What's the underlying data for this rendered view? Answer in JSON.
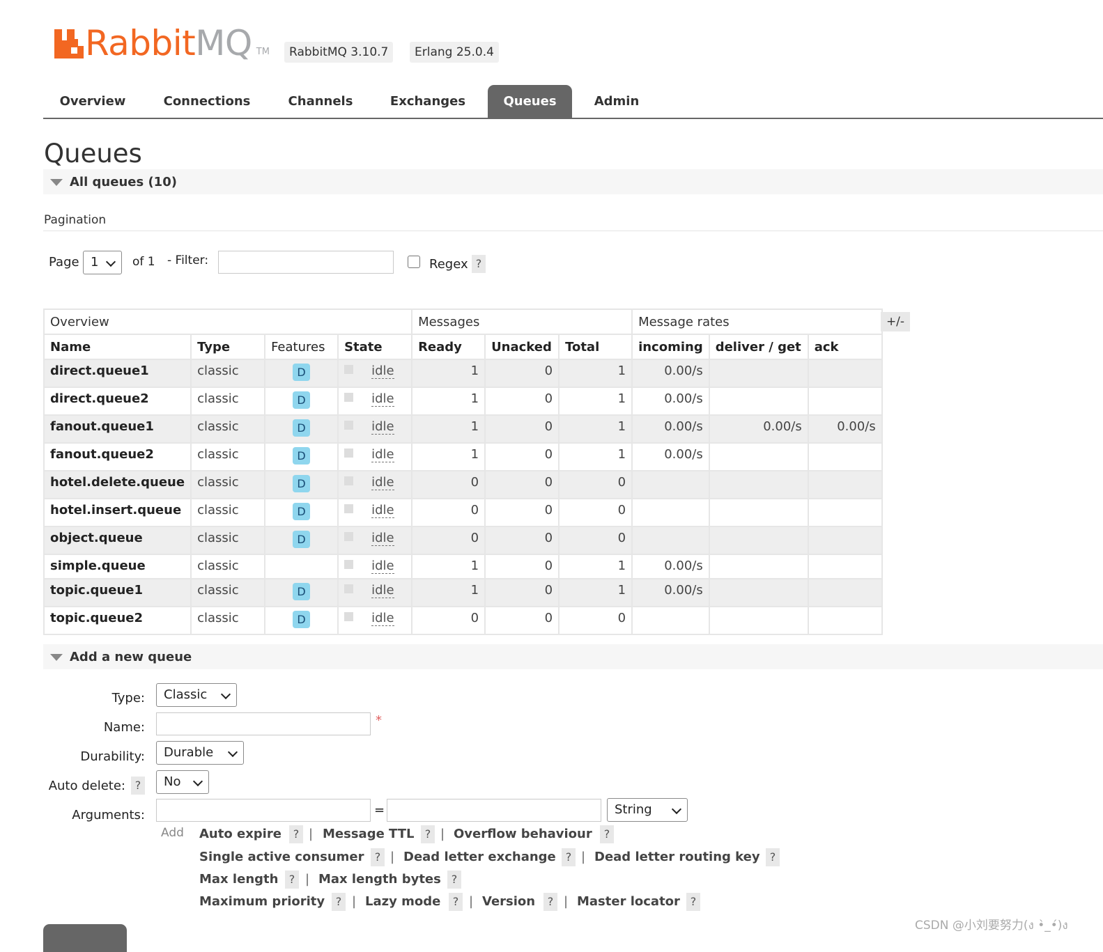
{
  "header": {
    "logo_text_rabbit": "Rabbit",
    "logo_text_mq": "MQ",
    "logo_tm": "TM",
    "rabbitmq_version": "RabbitMQ 3.10.7",
    "erlang_version": "Erlang 25.0.4"
  },
  "nav": {
    "tabs": [
      {
        "label": "Overview"
      },
      {
        "label": "Connections"
      },
      {
        "label": "Channels"
      },
      {
        "label": "Exchanges"
      },
      {
        "label": "Queues"
      },
      {
        "label": "Admin"
      }
    ],
    "active": "Queues"
  },
  "page_title": "Queues",
  "all_queues_label": "All queues (10)",
  "pagination": {
    "title": "Pagination",
    "page_label": "Page",
    "page_value": "1",
    "of_label": "of 1",
    "filter_label": "- Filter:",
    "filter_value": "",
    "regex_label": "Regex",
    "help": "?"
  },
  "table": {
    "groups": {
      "overview": "Overview",
      "messages": "Messages",
      "rates": "Message rates"
    },
    "toggle": "+/-",
    "columns": {
      "name": "Name",
      "type": "Type",
      "features": "Features",
      "state": "State",
      "ready": "Ready",
      "unacked": "Unacked",
      "total": "Total",
      "incoming": "incoming",
      "deliver_get": "deliver / get",
      "ack": "ack"
    },
    "rows": [
      {
        "name": "direct.queue1",
        "type": "classic",
        "feature": "D",
        "state": "idle",
        "ready": "1",
        "unacked": "0",
        "total": "1",
        "incoming": "0.00/s",
        "deliver_get": "",
        "ack": ""
      },
      {
        "name": "direct.queue2",
        "type": "classic",
        "feature": "D",
        "state": "idle",
        "ready": "1",
        "unacked": "0",
        "total": "1",
        "incoming": "0.00/s",
        "deliver_get": "",
        "ack": ""
      },
      {
        "name": "fanout.queue1",
        "type": "classic",
        "feature": "D",
        "state": "idle",
        "ready": "1",
        "unacked": "0",
        "total": "1",
        "incoming": "0.00/s",
        "deliver_get": "0.00/s",
        "ack": "0.00/s"
      },
      {
        "name": "fanout.queue2",
        "type": "classic",
        "feature": "D",
        "state": "idle",
        "ready": "1",
        "unacked": "0",
        "total": "1",
        "incoming": "0.00/s",
        "deliver_get": "",
        "ack": ""
      },
      {
        "name": "hotel.delete.queue",
        "type": "classic",
        "feature": "D",
        "state": "idle",
        "ready": "0",
        "unacked": "0",
        "total": "0",
        "incoming": "",
        "deliver_get": "",
        "ack": ""
      },
      {
        "name": "hotel.insert.queue",
        "type": "classic",
        "feature": "D",
        "state": "idle",
        "ready": "0",
        "unacked": "0",
        "total": "0",
        "incoming": "",
        "deliver_get": "",
        "ack": ""
      },
      {
        "name": "object.queue",
        "type": "classic",
        "feature": "D",
        "state": "idle",
        "ready": "0",
        "unacked": "0",
        "total": "0",
        "incoming": "",
        "deliver_get": "",
        "ack": ""
      },
      {
        "name": "simple.queue",
        "type": "classic",
        "feature": "",
        "state": "idle",
        "ready": "1",
        "unacked": "0",
        "total": "1",
        "incoming": "0.00/s",
        "deliver_get": "",
        "ack": ""
      },
      {
        "name": "topic.queue1",
        "type": "classic",
        "feature": "D",
        "state": "idle",
        "ready": "1",
        "unacked": "0",
        "total": "1",
        "incoming": "0.00/s",
        "deliver_get": "",
        "ack": ""
      },
      {
        "name": "topic.queue2",
        "type": "classic",
        "feature": "D",
        "state": "idle",
        "ready": "0",
        "unacked": "0",
        "total": "0",
        "incoming": "",
        "deliver_get": "",
        "ack": ""
      }
    ]
  },
  "add_queue": {
    "section_label": "Add a new queue",
    "type_label": "Type:",
    "type_value": "Classic",
    "name_label": "Name:",
    "name_value": "",
    "required_mark": "*",
    "durability_label": "Durability:",
    "durability_value": "Durable",
    "auto_delete_label": "Auto delete:",
    "auto_delete_value": "No",
    "arguments_label": "Arguments:",
    "equals": "=",
    "arg_type_value": "String",
    "add_label": "Add",
    "links": [
      "Auto expire",
      "Message TTL",
      "Overflow behaviour",
      "Single active consumer",
      "Dead letter exchange",
      "Dead letter routing key",
      "Max length",
      "Max length bytes",
      "Maximum priority",
      "Lazy mode",
      "Version",
      "Master locator"
    ],
    "separator": "|"
  },
  "watermark": "CSDN @小刘要努力(ง •̀_•́)ง",
  "colors": {
    "brand_orange": "#f26722",
    "logo_grey": "#a7a9ac",
    "tab_active": "#666666",
    "feature_badge": "#8fd6ee"
  }
}
